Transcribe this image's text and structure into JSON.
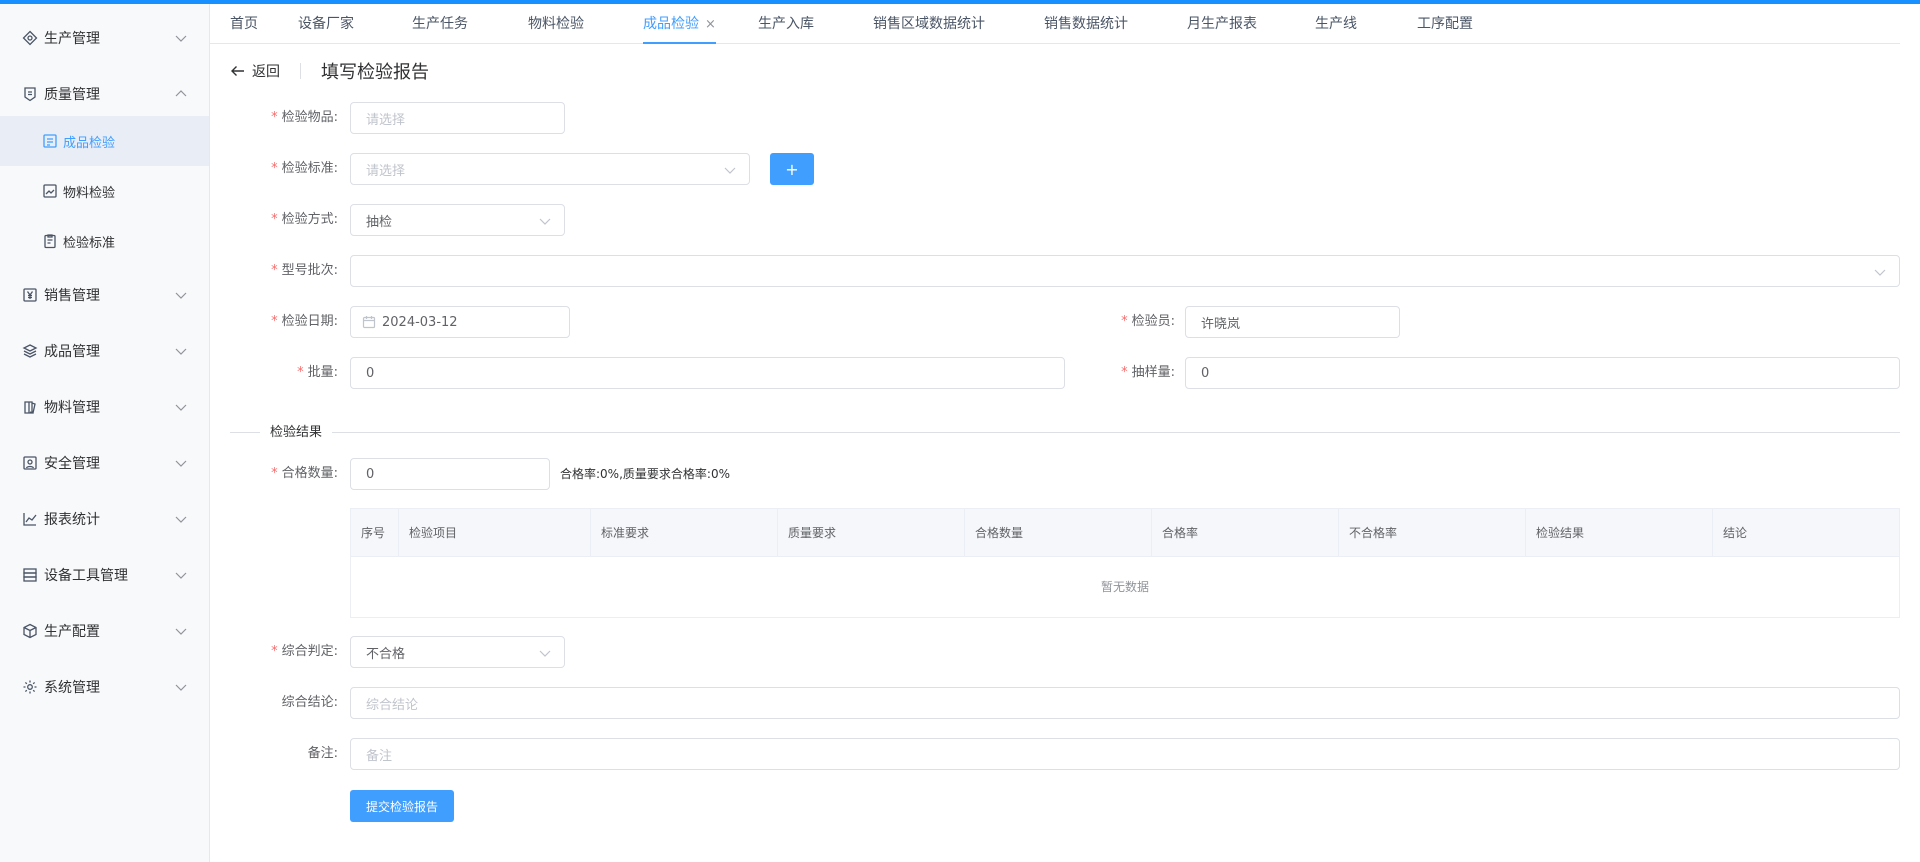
{
  "sidebar": {
    "menus": [
      {
        "label": "生产管理",
        "icon": "diamond-icon"
      },
      {
        "label": "质量管理",
        "icon": "badge-icon"
      },
      {
        "label": "销售管理",
        "icon": "yen-icon"
      },
      {
        "label": "成品管理",
        "icon": "layers-icon"
      },
      {
        "label": "物料管理",
        "icon": "book-icon"
      },
      {
        "label": "安全管理",
        "icon": "shield-icon"
      },
      {
        "label": "报表统计",
        "icon": "chart-line-icon"
      },
      {
        "label": "设备工具管理",
        "icon": "server-icon"
      },
      {
        "label": "生产配置",
        "icon": "cube-icon"
      },
      {
        "label": "系统管理",
        "icon": "gear-icon"
      }
    ],
    "submenus": [
      {
        "label": "成品检验",
        "active": true
      },
      {
        "label": "物料检验",
        "active": false
      },
      {
        "label": "检验标准",
        "active": false
      }
    ]
  },
  "tabs": [
    {
      "label": "首页"
    },
    {
      "label": "设备厂家"
    },
    {
      "label": "生产任务"
    },
    {
      "label": "物料检验"
    },
    {
      "label": "成品检验",
      "active": true,
      "close": "×"
    },
    {
      "label": "生产入库"
    },
    {
      "label": "销售区域数据统计"
    },
    {
      "label": "销售数据统计"
    },
    {
      "label": "月生产报表"
    },
    {
      "label": "生产线"
    },
    {
      "label": "工序配置"
    }
  ],
  "header": {
    "back": "返回",
    "title": "填写检验报告"
  },
  "form": {
    "item_label": "检验物品:",
    "item_placeholder": "请选择",
    "standard_label": "检验标准:",
    "standard_placeholder": "请选择",
    "add_button": "+",
    "method_label": "检验方式:",
    "method_value": "抽检",
    "batch_label": "型号批次:",
    "batch_value": "",
    "date_label": "检验日期:",
    "date_value": "2024-03-12",
    "inspector_label": "检验员:",
    "inspector_value": "许晓岚",
    "quantity_label": "批量:",
    "quantity_value": "0",
    "sample_label": "抽样量:",
    "sample_value": "0",
    "section_title": "检验结果",
    "qualified_label": "合格数量:",
    "qualified_value": "0",
    "rate_text": "合格率:0%,质量要求合格率:0%",
    "judgement_label": "综合判定:",
    "judgement_value": "不合格",
    "conclusion_label": "综合结论:",
    "conclusion_placeholder": "综合结论",
    "remark_label": "备注:",
    "remark_placeholder": "备注",
    "submit": "提交检验报告"
  },
  "table": {
    "columns": [
      "序号",
      "检验项目",
      "标准要求",
      "质量要求",
      "合格数量",
      "合格率",
      "不合格率",
      "检验结果",
      "结论"
    ],
    "empty_text": "暂无数据"
  },
  "colors": {
    "accent": "#409eff",
    "required": "#f56c6c",
    "topbar": "#1890ff"
  }
}
